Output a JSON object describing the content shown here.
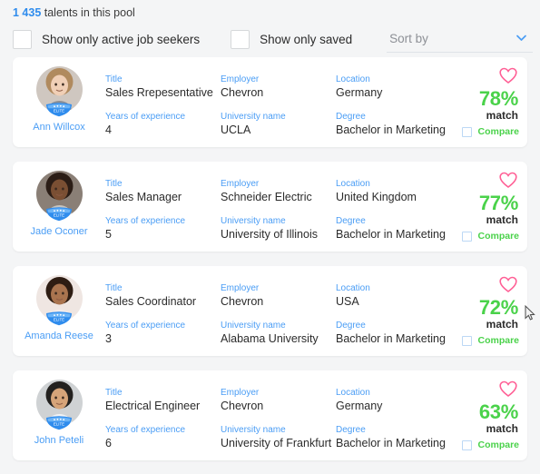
{
  "header": {
    "count": "1 435",
    "count_suffix": " talents in this pool"
  },
  "filters": {
    "active_seekers_label": "Show only active job seekers",
    "saved_label": "Show only saved",
    "sort_by_placeholder": "Sort by",
    "sort_by_value": "Sort by",
    "chevron_icon": "chevron-down-icon",
    "checkbox_checked": false
  },
  "labels": {
    "title": "Title",
    "employer": "Employer",
    "location": "Location",
    "years": "Years of experience",
    "university": "University name",
    "degree": "Degree",
    "match": "match",
    "compare": "Compare",
    "favorite_icon": "heart-icon",
    "badge_icon": "elite-badge-icon"
  },
  "colors": {
    "accent_blue": "#4a9df5",
    "match_green": "#4ad24a",
    "heart_pink": "#ff5f95",
    "page_bg": "#f4f5f6",
    "card_bg": "#ffffff"
  },
  "candidates": [
    {
      "name": "Ann Willcox",
      "title": "Sales Rrepesentative",
      "employer": "Chevron",
      "location": "Germany",
      "years": "4",
      "university": "UCLA",
      "degree": "Bachelor in Marketing",
      "match": "78%",
      "badge": "ELITE"
    },
    {
      "name": "Jade Oconer",
      "title": "Sales Manager",
      "employer": "Schneider Electric",
      "location": "United Kingdom",
      "years": "5",
      "university": "University of Illinois",
      "degree": "Bachelor in Marketing",
      "match": "77%",
      "badge": "ELITE"
    },
    {
      "name": "Amanda Reese",
      "title": "Sales Coordinator",
      "employer": "Chevron",
      "location": "USA",
      "years": "3",
      "university": "Alabama University",
      "degree": "Bachelor in Marketing",
      "match": "72%",
      "badge": "ELITE"
    },
    {
      "name": "John Peteli",
      "title": "Electrical Engineer",
      "employer": "Chevron",
      "location": "Germany",
      "years": "6",
      "university": "University of Frankfurt",
      "degree": "Bachelor in Marketing",
      "match": "63%",
      "badge": "ELITE"
    }
  ]
}
